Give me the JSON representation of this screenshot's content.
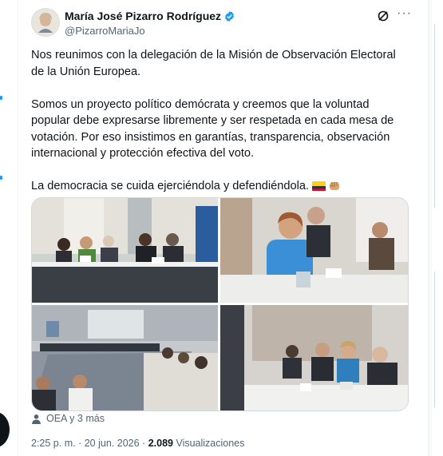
{
  "author": {
    "name": "María José Pizarro Rodríguez",
    "handle": "@PizarroMariaJo",
    "verified": true,
    "avatar_icon": "profile-photo"
  },
  "tweet": {
    "paragraphs": [
      "Nos reunimos con la delegación de la Misión de Observación Electoral de la Unión Europea.",
      "Somos un proyecto político demócrata y creemos que la voluntad popular debe expresarse libremente y ser respetada en cada mesa de votación. Por eso insistimos en garantías, transparencia, observación internacional y protección efectiva del voto.",
      "La democracia se cuida ejerciéndola y defendiéndola."
    ],
    "emojis": [
      "colombia-flag-icon",
      "fist-icon"
    ]
  },
  "media": {
    "count": 4,
    "photos": [
      {
        "name": "photo-meeting-table"
      },
      {
        "name": "photo-woman-speaking"
      },
      {
        "name": "photo-conference-room"
      },
      {
        "name": "photo-delegation"
      }
    ]
  },
  "tagged": {
    "label": "OEA y 3 más"
  },
  "meta": {
    "time": "2:25 p. m.",
    "separator": "·",
    "date": "20 jun. 2026",
    "views_count": "2.089",
    "views_label": "Visualizaciones"
  },
  "colors": {
    "accent": "#1d9bf0",
    "text": "#0f1419",
    "secondary": "#536471",
    "border": "#cfd9de"
  }
}
